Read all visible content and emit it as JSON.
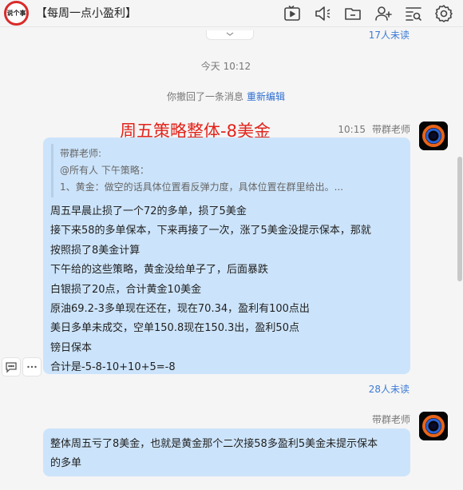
{
  "header": {
    "logo_text": "说个事",
    "title": "【每周一点小盈利】",
    "toolbar_icons": [
      "video-icon",
      "announcement-icon",
      "folder-icon",
      "add-member-icon",
      "search-history-icon",
      "settings-icon"
    ]
  },
  "chat": {
    "unread_top": "17人未读",
    "timestamp": "今天 10:12",
    "recall_notice": "你撤回了一条消息",
    "recall_action": "重新编辑",
    "headline": "周五策略整体-8美金",
    "message1": {
      "time": "10:15",
      "sender": "带群老师",
      "quote_lines": [
        "带群老师:",
        "@所有人 下午策略：",
        "1、黄金：做空的话具体位置看反弹力度，具体位置在群里给出。..."
      ],
      "lines": [
        "周五早晨止损了一个72的多单，损了5美金",
        "接下来58的多单保本，下来再接了一次，涨了5美金没提示保本，那就",
        "按照损了8美金计算",
        "下午给的这些策略，黄金没给单子了，后面暴跌",
        "白银损了20点，合计黄金10美金",
        "原油69.2-3多单现在还在，现在70.34，盈利有100点出",
        "美日多单未成交，空单150.8现在150.3出，盈利50点",
        "镑日保本",
        "合计是-5-8-10+10+5=-8"
      ],
      "unread": "28人未读"
    },
    "message2": {
      "sender": "带群老师",
      "lines": [
        "整体周五亏了8美金，也就是黄金那个二次接58多盈利5美金未提示保本",
        "的多单"
      ]
    }
  },
  "colors": {
    "headline": "#e2231a",
    "bubble": "#cce4fb",
    "link": "#2f6fd1"
  }
}
